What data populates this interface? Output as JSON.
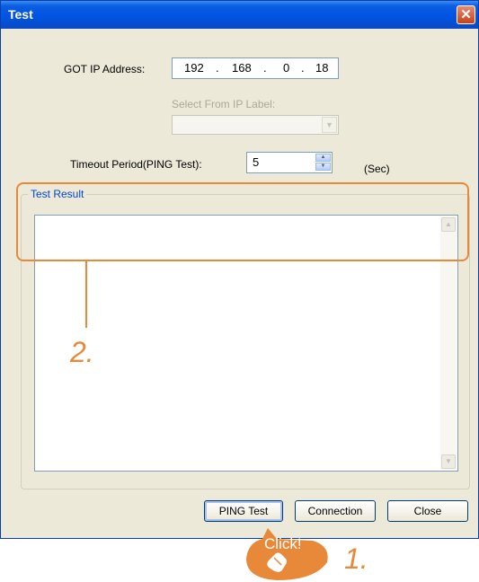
{
  "window": {
    "title": "Test",
    "close_glyph": "✕"
  },
  "form": {
    "got_ip_label": "GOT IP Address:",
    "ip_octets": [
      "192",
      "168",
      "0",
      "18"
    ],
    "ip_dot": ".",
    "select_ip_label": "Select From IP Label:",
    "select_ip_value": "",
    "timeout_label": "Timeout Period(PING Test):",
    "timeout_value": "5",
    "timeout_unit": "(Sec)"
  },
  "result": {
    "group_title": "Test Result",
    "text": ""
  },
  "buttons": {
    "ping": "PING Test",
    "connection": "Connection",
    "close": "Close"
  },
  "annotations": {
    "click_label": "Click!",
    "step1": "1.",
    "step2": "2."
  },
  "colors": {
    "titlebar": "#0054e3",
    "accent_orange": "#e8893a",
    "dialog_bg": "#ece9d8"
  },
  "icons": [
    "close-icon",
    "dropdown-arrow-icon",
    "spin-up-icon",
    "spin-down-icon",
    "scroll-up-icon",
    "scroll-down-icon",
    "mouse-cursor-icon"
  ]
}
